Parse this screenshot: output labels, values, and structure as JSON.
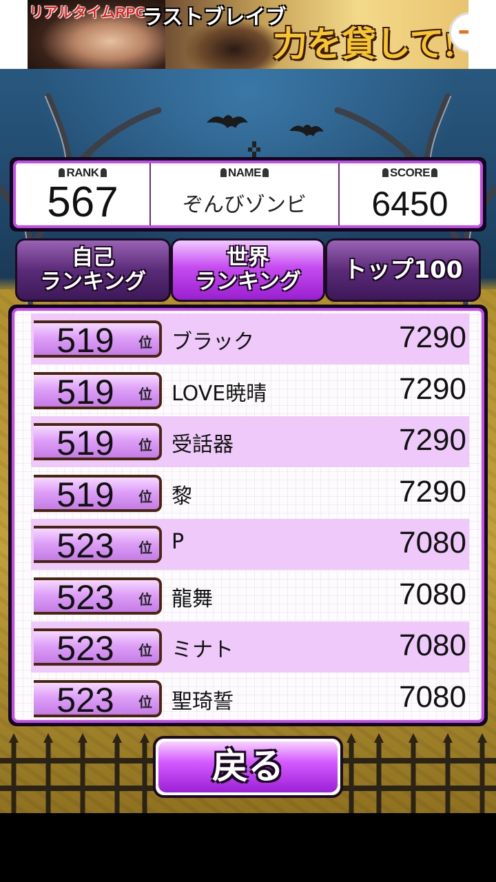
{
  "ad": {
    "line1": "リアルタイムRPG",
    "line2": "ラストブレイブ",
    "line3": "力を貸して!",
    "arrow_icon": "arrow-right-icon"
  },
  "header": {
    "rank_label": "RANK",
    "rank_value": "567",
    "name_label": "NAME",
    "name_value": "ぞんびゾンビ",
    "score_label": "SCORE",
    "score_value": "6450"
  },
  "tabs": {
    "self": {
      "line1": "自己",
      "line2": "ランキング"
    },
    "world": {
      "line1": "世界",
      "line2": "ランキング"
    },
    "top": {
      "label": "トップ100"
    },
    "selected": "world"
  },
  "ranking": {
    "suffix": "位",
    "rows": [
      {
        "rank": "519",
        "name": "ブラック",
        "score": "7290"
      },
      {
        "rank": "519",
        "name": "LOVE暁晴",
        "score": "7290"
      },
      {
        "rank": "519",
        "name": "受話器",
        "score": "7290"
      },
      {
        "rank": "519",
        "name": "黎",
        "score": "7290"
      },
      {
        "rank": "523",
        "name": "P",
        "score": "7080"
      },
      {
        "rank": "523",
        "name": "龍舞",
        "score": "7080"
      },
      {
        "rank": "523",
        "name": "ミナト",
        "score": "7080"
      },
      {
        "rank": "523",
        "name": "聖琦誓",
        "score": "7080"
      }
    ]
  },
  "back_button": {
    "label": "戻る"
  },
  "colors": {
    "accent": "#c64cf0",
    "row_highlight": "#efc9fa",
    "frame": "#12061c"
  }
}
